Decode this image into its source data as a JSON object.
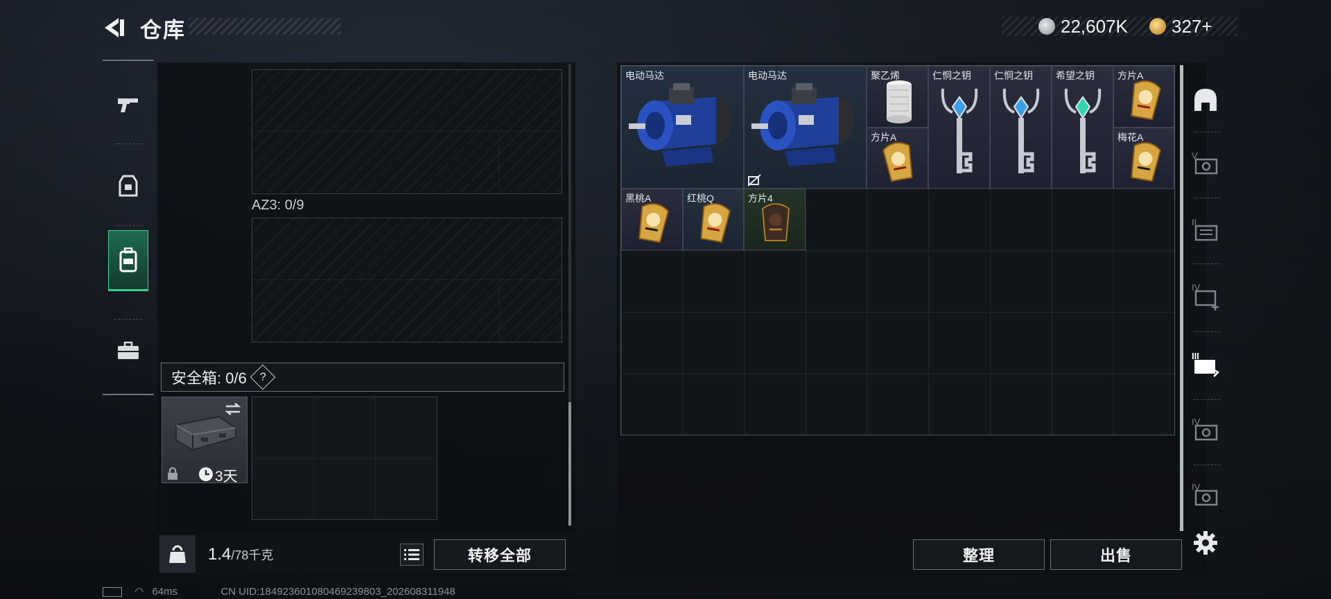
{
  "header": {
    "title": "仓库",
    "currencies": [
      {
        "icon": "silver-coin-icon",
        "value": "22,607K"
      },
      {
        "icon": "gold-coin-icon",
        "value": "327+"
      }
    ]
  },
  "left_rail": [
    {
      "icon": "gun-icon",
      "active": false
    },
    {
      "icon": "armor-vest-icon",
      "active": false
    },
    {
      "icon": "backpack-icon",
      "active": true
    },
    {
      "icon": "briefcase-icon",
      "active": false
    }
  ],
  "left_panel": {
    "az_label": "AZ3: 0/9",
    "safe_box": {
      "label": "安全箱: 0/6",
      "help": "?",
      "timer": "3天"
    },
    "weight": {
      "current": "1.4",
      "max": "/78千克"
    },
    "kg_icon": "KG",
    "transfer_all": "转移全部"
  },
  "stash_items": [
    {
      "name": "电动马达",
      "icon": "electric-motor-icon"
    },
    {
      "name": "电动马达",
      "icon": "electric-motor-icon"
    },
    {
      "name": "聚乙烯",
      "icon": "polyethylene-roll-icon"
    },
    {
      "name": "方片A",
      "icon": "card-icon"
    },
    {
      "name": "仁恫之钥",
      "icon": "ornate-key-icon"
    },
    {
      "name": "仁恫之钥",
      "icon": "ornate-key-icon"
    },
    {
      "name": "希望之钥",
      "icon": "ornate-key-icon"
    },
    {
      "name": "方片A",
      "icon": "card-icon"
    },
    {
      "name": "梅花A",
      "icon": "card-icon"
    },
    {
      "name": "黑桃A",
      "icon": "card-icon"
    },
    {
      "name": "红桃Q",
      "icon": "card-icon"
    },
    {
      "name": "方片4",
      "icon": "card-icon"
    }
  ],
  "actions": {
    "sort": "整理",
    "sell": "出售"
  },
  "right_rail": [
    {
      "icon": "helmet-icon"
    },
    {
      "icon": "stash-v-icon",
      "label": "V"
    },
    {
      "icon": "stash-ii-icon",
      "label": "II"
    },
    {
      "icon": "stash-iv-add-icon",
      "label": "IV"
    },
    {
      "icon": "stash-iii-icon",
      "label": "III"
    },
    {
      "icon": "stash-iv-icon",
      "label": "IV"
    },
    {
      "icon": "stash-iv-icon",
      "label": "IV"
    },
    {
      "icon": "gear-icon"
    }
  ],
  "status": {
    "ping": "64ms",
    "uid": "CN UID:18492360108046923980​3_202608311948"
  },
  "colors": {
    "accent_green": "#3ad08d",
    "gold": "#d8a640",
    "blue_motor": "#1e3f9a"
  }
}
